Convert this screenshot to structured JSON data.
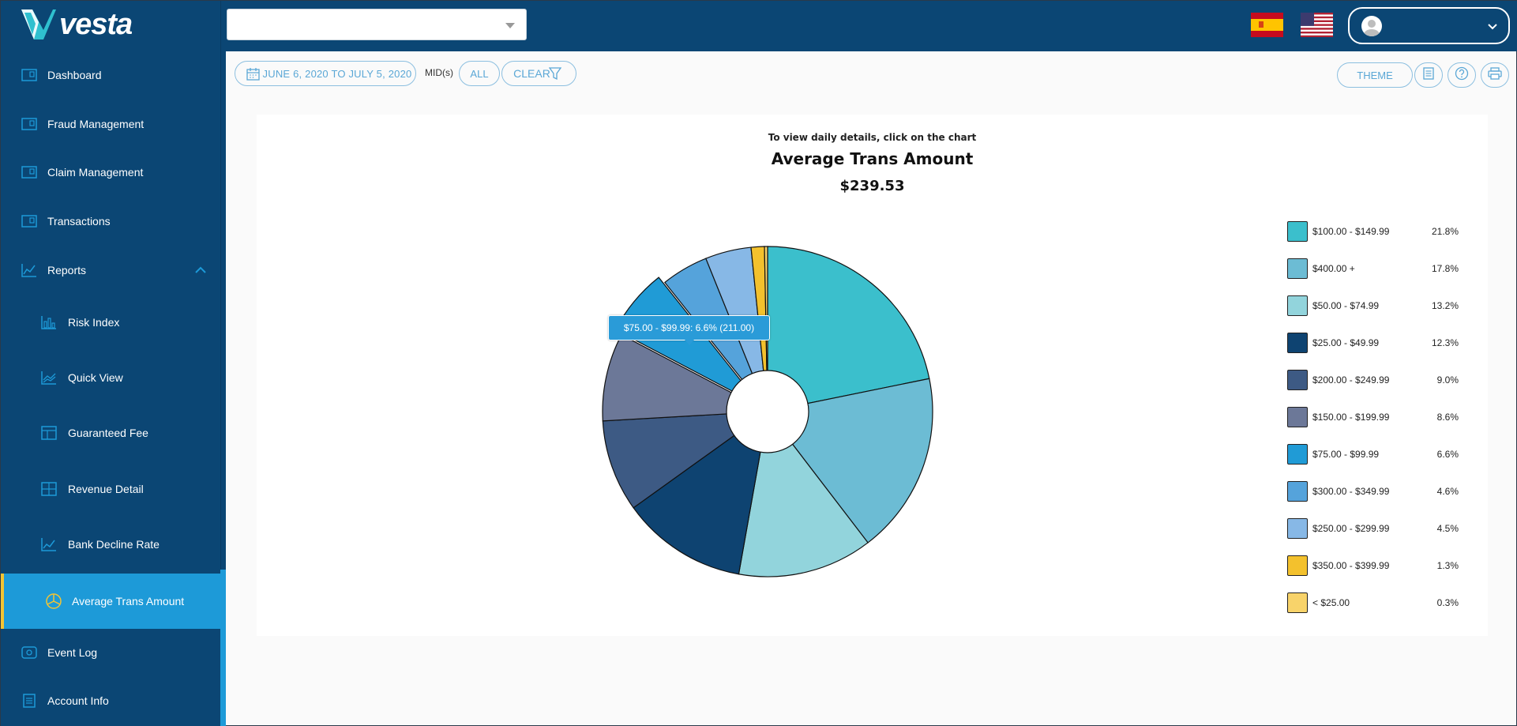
{
  "brand": {
    "logo_text": "vesta"
  },
  "sidebar": {
    "items": [
      {
        "label": "Dashboard"
      },
      {
        "label": "Fraud Management"
      },
      {
        "label": "Claim Management"
      },
      {
        "label": "Transactions"
      },
      {
        "label": "Reports"
      },
      {
        "label": "Risk Index"
      },
      {
        "label": "Quick View"
      },
      {
        "label": "Guaranteed Fee"
      },
      {
        "label": "Revenue Detail"
      },
      {
        "label": "Bank Decline Rate"
      },
      {
        "label": "Average Trans Amount"
      },
      {
        "label": "Event Log"
      },
      {
        "label": "Account Info"
      }
    ],
    "active_item": "Average Trans Amount"
  },
  "topbar": {
    "mid_select_value": "",
    "languages": [
      "es",
      "en-US"
    ]
  },
  "filters": {
    "date_range": "JUNE 6, 2020 TO JULY 5, 2020",
    "mids_label": "MID(s)",
    "all_label": "ALL",
    "clear_label": "CLEAR",
    "theme_label": "THEME"
  },
  "colors": {
    "accent": "#1d9ad8",
    "sidebar_bg": "#0b4674",
    "active_border": "#f3c433"
  },
  "chart_data": {
    "type": "pie",
    "hint": "To view daily details, click on the chart",
    "title": "Average Trans Amount",
    "subtitle": "$239.53",
    "series": [
      {
        "name": "$100.00 - $149.99",
        "percent": 21.8,
        "color": "#3bbfcc"
      },
      {
        "name": "$400.00 +",
        "percent": 17.8,
        "color": "#6cbcd4"
      },
      {
        "name": "$50.00 - $74.99",
        "percent": 13.2,
        "color": "#92d4dc"
      },
      {
        "name": "$25.00 - $49.99",
        "percent": 12.3,
        "color": "#0e4371"
      },
      {
        "name": "$200.00 - $249.99",
        "percent": 9.0,
        "color": "#3d5a84"
      },
      {
        "name": "$150.00 - $199.99",
        "percent": 8.6,
        "color": "#6c7898"
      },
      {
        "name": "$75.00 - $99.99",
        "percent": 6.6,
        "color": "#209bd6"
      },
      {
        "name": "$300.00 - $349.99",
        "percent": 4.6,
        "color": "#55a3db"
      },
      {
        "name": "$250.00 - $299.99",
        "percent": 4.5,
        "color": "#87b8e6"
      },
      {
        "name": "$350.00 - $399.99",
        "percent": 1.3,
        "color": "#f3c12d"
      },
      {
        "name": "< $25.00",
        "percent": 0.3,
        "color": "#f8d36a"
      }
    ],
    "legend_percent_labels": [
      "21.8%",
      "17.8%",
      "13.2%",
      "12.3%",
      "9.0%",
      "8.6%",
      "6.6%",
      "4.6%",
      "4.5%",
      "1.3%",
      "0.3%"
    ],
    "legend_position": "right",
    "highlighted_slice": "$75.00 - $99.99",
    "tooltip": "$75.00 - $99.99: 6.6% (211.00)"
  }
}
